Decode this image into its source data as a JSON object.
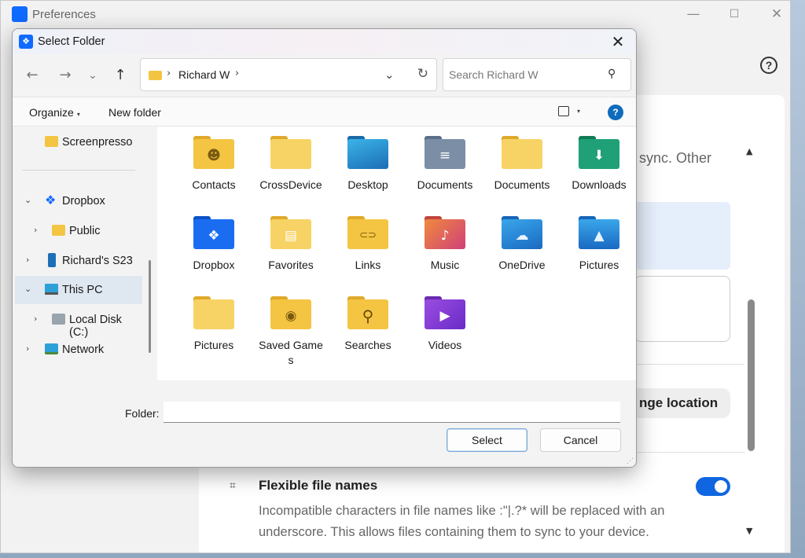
{
  "prefs": {
    "title": "Preferences",
    "minimize": "—",
    "maximize": "☐",
    "close": "✕",
    "help": "?",
    "sync_text": "sync. Other",
    "change_location": "nge location",
    "scroll_up": "▲",
    "scroll_down": "▼",
    "flex_icon": "⌗",
    "flexible_title": "Flexible file names",
    "flexible_desc": "Incompatible characters in file names like :\"|.?* will be replaced with an underscore. This allows files containing them to sync to your device.",
    "flexible_enabled": true
  },
  "dialog": {
    "title": "Select Folder",
    "logo_glyph": "❖",
    "close": "✕",
    "nav": {
      "back": "←",
      "forward": "→",
      "recent": "⌄",
      "up": "↑"
    },
    "address": {
      "path": "Richard W",
      "separator": "›",
      "dropdown": "⌄",
      "refresh": "↻"
    },
    "search": {
      "placeholder": "Search Richard W",
      "icon": "⚲"
    },
    "commands": {
      "organize": "Organize",
      "organize_caret": "▾",
      "new_folder": "New folder",
      "view_caret": "▾",
      "help": "?"
    },
    "nav_pane": {
      "items": [
        {
          "label": "Screenpresso",
          "chevron": "",
          "icon": "folder"
        },
        {
          "label": "Dropbox",
          "chevron": "⌄",
          "icon": "dropbox"
        },
        {
          "label": "Public",
          "chevron": "›",
          "icon": "folder"
        },
        {
          "label": "Richard's S23",
          "chevron": "›",
          "icon": "phone"
        },
        {
          "label": "This PC",
          "chevron": "⌄",
          "icon": "monitor"
        },
        {
          "label": "Local Disk (C:)",
          "chevron": "›",
          "icon": "disk"
        },
        {
          "label": "Network",
          "chevron": "›",
          "icon": "network"
        }
      ]
    },
    "tiles": [
      {
        "label": "Contacts",
        "emblem": "☻"
      },
      {
        "label": "CrossDevice",
        "emblem": ""
      },
      {
        "label": "Desktop",
        "emblem": ""
      },
      {
        "label": "Documents",
        "emblem": "≡"
      },
      {
        "label": "Documents",
        "emblem": ""
      },
      {
        "label": "Downloads",
        "emblem": "⬇"
      },
      {
        "label": "Dropbox",
        "emblem": "❖"
      },
      {
        "label": "Favorites",
        "emblem": "▤"
      },
      {
        "label": "Links",
        "emblem": "⊂⊃"
      },
      {
        "label": "Music",
        "emblem": "♪"
      },
      {
        "label": "OneDrive",
        "emblem": "☁"
      },
      {
        "label": "Pictures",
        "emblem": "▲"
      },
      {
        "label": "Pictures",
        "emblem": ""
      },
      {
        "label": "Saved Games",
        "emblem": "◉"
      },
      {
        "label": "Searches",
        "emblem": "⚲"
      },
      {
        "label": "Videos",
        "emblem": "▶"
      }
    ],
    "footer": {
      "folder_label": "Folder:",
      "folder_value": "",
      "select": "Select",
      "cancel": "Cancel",
      "grip": "⋰"
    }
  },
  "colors": {
    "accent": "#0f6cbd",
    "folder_yellow": "#f4c542",
    "toggle_on": "#0f66e0",
    "selection": "#dfe7f1"
  }
}
